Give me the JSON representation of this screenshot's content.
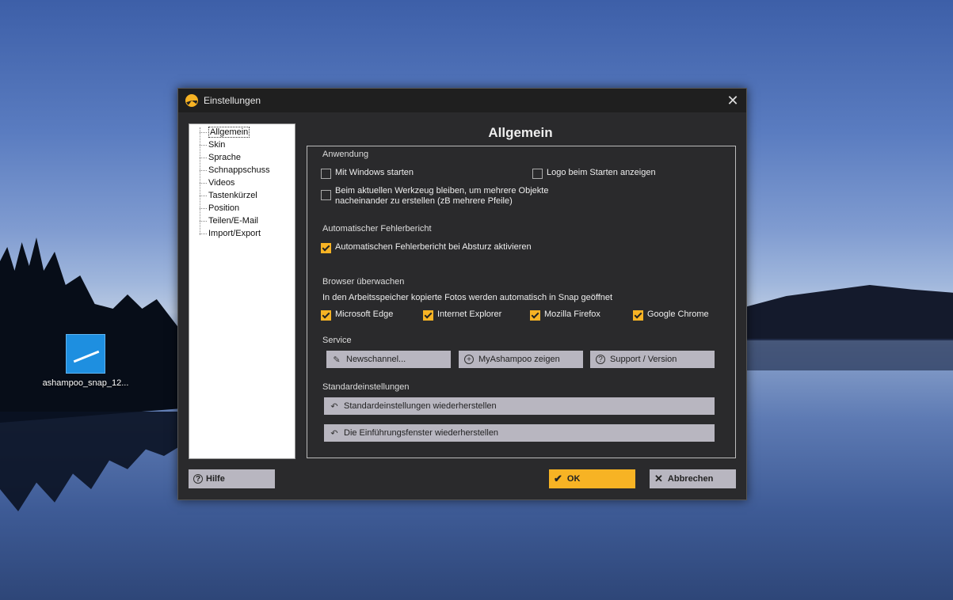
{
  "desktop": {
    "icon_label": "ashampoo_snap_12..."
  },
  "dialog": {
    "title": "Einstellungen",
    "close_symbol": "✕",
    "nav": [
      "Allgemein",
      "Skin",
      "Sprache",
      "Schnappschuss",
      "Videos",
      "Tastenkürzel",
      "Position",
      "Teilen/E-Mail",
      "Import/Export"
    ],
    "panel_title": "Allgemein",
    "sections": {
      "anwendung": {
        "heading": "Anwendung",
        "mit_windows": "Mit Windows starten",
        "logo": "Logo beim Starten anzeigen",
        "werkzeug_line1": "Beim aktuellen Werkzeug bleiben, um mehrere Objekte",
        "werkzeug_line2": "nacheinander zu erstellen (zB mehrere Pfeile)"
      },
      "fehlerbericht": {
        "heading": "Automatischer Fehlerbericht",
        "aktivieren": "Automatischen Fehlerbericht bei Absturz aktivieren"
      },
      "browser": {
        "heading": "Browser überwachen",
        "description": "In den Arbeitsspeicher kopierte Fotos werden automatisch in Snap geöffnet",
        "edge": "Microsoft Edge",
        "ie": "Internet Explorer",
        "firefox": "Mozilla Firefox",
        "chrome": "Google Chrome"
      },
      "service": {
        "heading": "Service",
        "newschannel": "Newschannel...",
        "myashampoo": "MyAshampoo zeigen",
        "support": "Support / Version"
      },
      "standard": {
        "heading": "Standardeinstellungen",
        "restore_defaults": "Standardeinstellungen wiederherstellen",
        "restore_intro": "Die Einführungsfenster wiederherstellen"
      }
    },
    "buttons": {
      "help": "Hilfe",
      "ok": "OK",
      "cancel": "Abbrechen"
    },
    "colors": {
      "accent": "#f7b324",
      "background": "#2a2a2c",
      "button": "#b8b6c0"
    }
  }
}
